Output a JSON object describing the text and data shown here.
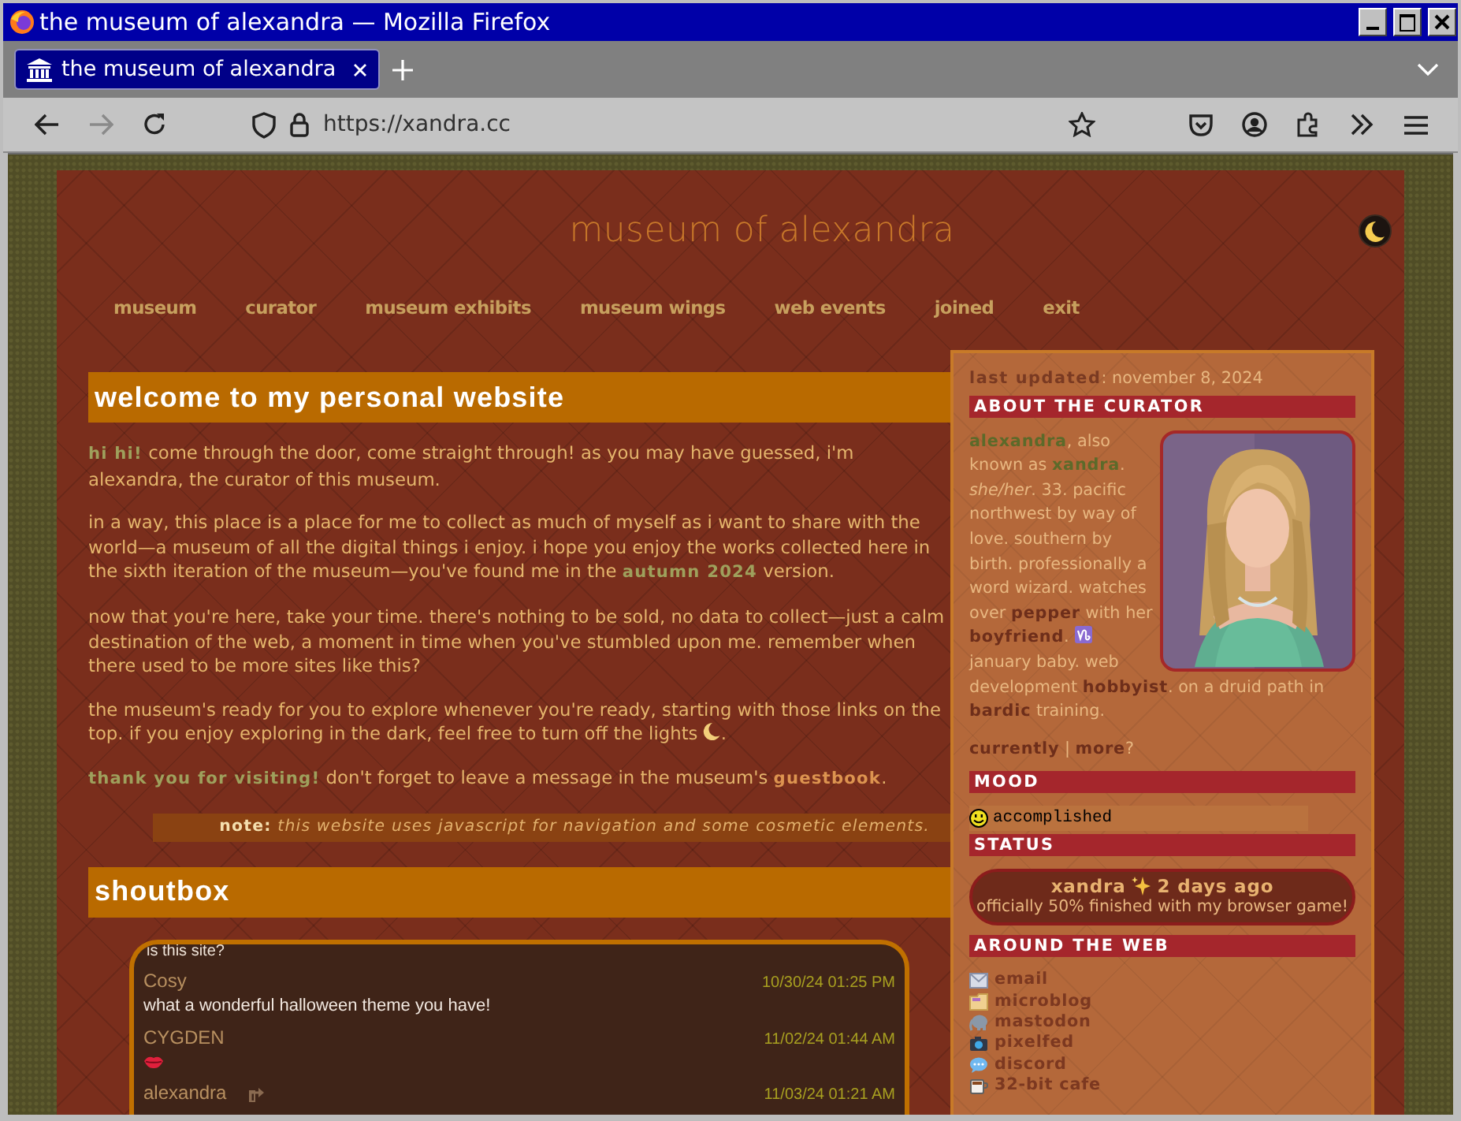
{
  "window": {
    "title": "the museum of alexandra — Mozilla Firefox"
  },
  "browser": {
    "tabs": [
      {
        "title": "the museum of alexandra",
        "selected": true
      }
    ],
    "url": "https://xandra.cc",
    "forward_disabled": true
  },
  "site": {
    "title": "museum of alexandra",
    "nav": [
      "museum",
      "curator",
      "museum exhibits",
      "museum wings",
      "web events",
      "joined",
      "exit"
    ],
    "welcome": {
      "heading": "welcome to my personal website",
      "paragraphs": [
        {
          "segments": [
            {
              "kind": "text",
              "text": "**hi hi!** come through the door, come straight through! as you may have guessed, i'm alexandra, the curator of this museum."
            }
          ]
        },
        {
          "segments": [
            {
              "kind": "text",
              "text": "in a way, this place is a place for me to collect as much of myself as i want to share with the world—a museum of all the digital things i enjoy. i hope you enjoy the works collected here in the sixth iteration of the museum—you've found me in the **autumn 2024** version."
            }
          ]
        },
        {
          "segments": [
            {
              "kind": "text",
              "text": "now that you're here, take your time. there's nothing to be sold, no data to collect—just a calm destination of the web, a moment in time when you've stumbled upon me. remember when there used to be more sites like this?"
            }
          ]
        },
        {
          "segments": [
            {
              "kind": "text",
              "text": "the museum's ready for you to explore whenever you're ready, starting with those links on the top. if you enjoy exploring in the dark, feel free to turn off the lights "
            },
            {
              "kind": "moon"
            },
            {
              "kind": "text",
              "text": "."
            }
          ]
        },
        {
          "segments": [
            {
              "kind": "text",
              "text": "**thank you for visiting!** don't forget to leave a message in the museum's "
            },
            {
              "kind": "link",
              "text": "guestbook"
            },
            {
              "kind": "text",
              "text": "."
            }
          ]
        }
      ],
      "note": "**note:** *this website uses javascript for navigation and some cosmetic elements.*"
    },
    "shoutbox": {
      "heading": "shoutbox",
      "messages": [
        {
          "kind": "fragment",
          "text": "is this site?"
        },
        {
          "kind": "post",
          "name": "Cosy",
          "time": "10/30/24 01:25 PM",
          "text": "what a wonderful halloween theme you have!",
          "replied": false
        },
        {
          "kind": "kiss",
          "name": "CYGDEN",
          "time": "11/02/24 01:44 AM",
          "replied": false
        },
        {
          "kind": "post",
          "name": "alexandra",
          "time": "11/03/24 01:21 AM",
          "replied": true
        }
      ]
    },
    "sidebar": {
      "last_updated": "**last updated**: november 8, 2024",
      "about_heading": "ABOUT THE CURATOR",
      "bio": [
        {
          "kind": "name",
          "text": "alexandra"
        },
        {
          "kind": "text",
          "text": ", also known as "
        },
        {
          "kind": "name",
          "text": "xandra"
        },
        {
          "kind": "text",
          "text": ". "
        },
        {
          "kind": "em",
          "text": "she/her"
        },
        {
          "kind": "text",
          "text": ". 33. pacific northwest by way of love. southern by birth. professionally a word wizard. watches over "
        },
        {
          "kind": "link",
          "text": "pepper"
        },
        {
          "kind": "text",
          "text": " with her "
        },
        {
          "kind": "link",
          "text": "boyfriend"
        },
        {
          "kind": "text",
          "text": ". "
        },
        {
          "kind": "capricorn"
        },
        {
          "kind": "text",
          "text": " january baby. web development "
        },
        {
          "kind": "link",
          "text": "hobbyist"
        },
        {
          "kind": "text",
          "text": ". on a druid path in "
        },
        {
          "kind": "link",
          "text": "bardic"
        },
        {
          "kind": "text",
          "text": " training."
        }
      ],
      "more": [
        {
          "kind": "link",
          "text": "currently"
        },
        {
          "kind": "text",
          "text": " | "
        },
        {
          "kind": "link",
          "text": "more"
        },
        {
          "kind": "text",
          "text": "?"
        }
      ],
      "mood_heading": "MOOD",
      "mood": "accomplished",
      "status_heading": "STATUS",
      "status": {
        "user": "xandra",
        "time": "2 days ago",
        "message": "officially 50% finished with my browser game!"
      },
      "web_heading": "AROUND THE WEB",
      "links": [
        {
          "kind": "email",
          "label": "email"
        },
        {
          "kind": "microblog",
          "label": "microblog"
        },
        {
          "kind": "mastodon",
          "label": "mastodon"
        },
        {
          "kind": "pixelfed",
          "label": "pixelfed"
        },
        {
          "kind": "discord",
          "label": "discord"
        },
        {
          "kind": "cafe",
          "label": "32-bit cafe"
        }
      ]
    }
  }
}
